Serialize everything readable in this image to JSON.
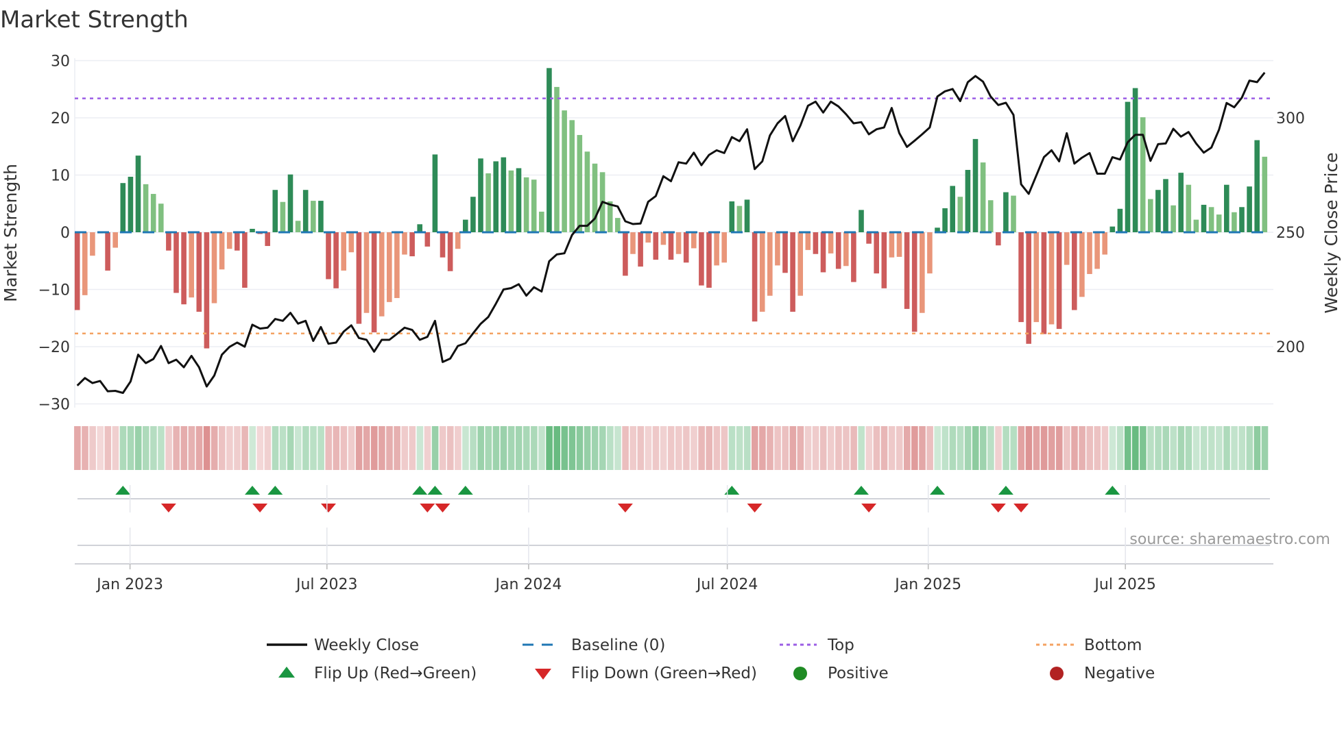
{
  "chart_data": {
    "type": "bar",
    "title": "Market Strength",
    "ylabel": "Market Strength",
    "y2label": "Weekly Close Price",
    "ylim": [
      -30,
      30
    ],
    "y2lim": [
      175,
      325
    ],
    "yticks": [
      30,
      20,
      10,
      0,
      -10,
      -20,
      -30
    ],
    "y2ticks": [
      300,
      250,
      200
    ],
    "top_level": 23.4,
    "bottom_level": -17.7,
    "x_ticks": [
      {
        "label": "Jan 2023",
        "week": 7.93
      },
      {
        "label": "Jul 2023",
        "week": 33.8
      },
      {
        "label": "Jan 2024",
        "week": 60.3
      },
      {
        "label": "Jul 2024",
        "week": 86.4
      },
      {
        "label": "Jan 2025",
        "week": 112.8
      },
      {
        "label": "Jul 2025",
        "week": 138.7
      }
    ],
    "strength": [
      -13.6,
      -11.0,
      -4.1,
      -0.2,
      -6.7,
      -2.7,
      8.6,
      9.7,
      13.4,
      8.4,
      6.7,
      5.0,
      -3.2,
      -10.6,
      -12.6,
      -11.4,
      -13.9,
      -20.3,
      -12.4,
      -6.5,
      -2.9,
      -3.2,
      -9.7,
      0.6,
      -0.3,
      -2.4,
      7.4,
      5.3,
      10.1,
      2.0,
      7.4,
      5.5,
      5.5,
      -8.2,
      -9.8,
      -6.7,
      -3.5,
      -16.0,
      -14.1,
      -17.5,
      -14.7,
      -12.2,
      -11.5,
      -3.9,
      -4.2,
      1.4,
      -2.5,
      13.6,
      -4.4,
      -6.8,
      -2.9,
      2.2,
      6.2,
      12.9,
      10.3,
      12.4,
      13.1,
      10.8,
      11.2,
      9.6,
      9.2,
      3.6,
      28.7,
      25.4,
      21.3,
      19.6,
      17.0,
      14.1,
      12.0,
      10.5,
      5.4,
      2.5,
      -7.6,
      -3.8,
      -6.0,
      -1.8,
      -4.8,
      -2.2,
      -4.8,
      -3.8,
      -5.3,
      -2.8,
      -9.3,
      -9.7,
      -5.8,
      -5.3,
      5.4,
      4.6,
      5.7,
      -15.6,
      -13.9,
      -11.1,
      -5.8,
      -7.1,
      -13.9,
      -11.1,
      -3.1,
      -3.8,
      -7.0,
      -3.7,
      -6.4,
      -5.9,
      -8.7,
      3.9,
      -2.0,
      -7.2,
      -9.8,
      -4.4,
      -4.3,
      -13.4,
      -17.4,
      -14.1,
      -7.2,
      0.8,
      4.2,
      8.1,
      6.2,
      10.9,
      16.3,
      12.2,
      5.6,
      -2.3,
      7.0,
      6.4,
      -15.7,
      -19.5,
      -15.7,
      -17.8,
      -16.1,
      -16.9,
      -5.7,
      -13.6,
      -11.3,
      -7.3,
      -6.4,
      -3.9,
      1.0,
      4.1,
      22.8,
      25.2,
      20.1,
      5.8,
      7.4,
      9.3,
      4.7,
      10.4,
      8.3,
      2.2,
      4.8,
      4.4,
      3.1,
      8.3,
      3.5,
      4.4,
      8.0,
      16.1,
      13.2
    ],
    "weekly_close": [
      183.0,
      186.3,
      184.1,
      185,
      180.5,
      180.7,
      179.8,
      184.8,
      196.5,
      192.8,
      194.6,
      200.3,
      192.8,
      194.3,
      191,
      196,
      191,
      182.6,
      187.4,
      196.5,
      199.9,
      201.8,
      200,
      209.6,
      207.9,
      208.3,
      212.1,
      211.3,
      214.8,
      210.1,
      211.3,
      202.5,
      208.6,
      201.3,
      201.8,
      206.6,
      209.3,
      203.8,
      203,
      197.8,
      203,
      203,
      205.6,
      208.3,
      207.3,
      203,
      204.3,
      211.3,
      193.3,
      194.8,
      200.3,
      201.5,
      205.8,
      210,
      213,
      218.8,
      225,
      225.6,
      227.3,
      222.3,
      226,
      224.1,
      237.3,
      240.3,
      240.8,
      248.8,
      252.8,
      252.8,
      256,
      263.3,
      262.1,
      261.3,
      254.8,
      253.6,
      253.8,
      263.3,
      265.8,
      274.5,
      272.3,
      280.6,
      280,
      284.8,
      279.3,
      283.8,
      285.8,
      284.6,
      291.6,
      289.8,
      295,
      277.6,
      281,
      292.3,
      297.6,
      300.8,
      289.8,
      296.6,
      305.3,
      307.1,
      302.3,
      307.1,
      305,
      301.6,
      297.6,
      298.1,
      292.8,
      295,
      295.8,
      304.3,
      293.3,
      287.3,
      290,
      292.8,
      295.8,
      309.3,
      311.6,
      312.6,
      307.3,
      315.6,
      318.3,
      315.8,
      309.3,
      305.6,
      306.6,
      301.3,
      271,
      266.8,
      274.8,
      282.8,
      285.8,
      281,
      293.3,
      280,
      282.6,
      284.6,
      275.6,
      275.6,
      282.8,
      281.8,
      289.3,
      292.6,
      292.6,
      281.2,
      288.5,
      288.8,
      295.2,
      291.8,
      293.8,
      288.8,
      284.8,
      287,
      294.8,
      306.5,
      304.6,
      308.8,
      316.3,
      315.6,
      319.8
    ],
    "legend": {
      "placement": "bottom",
      "weekly_close": "Weekly Close",
      "baseline": "Baseline (0)",
      "top": "Top",
      "bottom": "Bottom",
      "flip_up": "Flip Up (Red→Green)",
      "flip_down": "Flip Down (Green→Red)",
      "positive": "Positive",
      "negative": "Negative"
    },
    "source": "source: sharemaestro.com"
  },
  "colors": {
    "up_strong": "#2e8b57",
    "up_weak": "#80c080",
    "down_strong": "#cd5c5c",
    "down_weak": "#e9967a",
    "close": "#111111",
    "baseline": "#1f77b4",
    "top": "#9b5de5",
    "bottom": "#f4a261",
    "flip_up": "#1a9641",
    "flip_down": "#d62728",
    "positive": "#1f8b24",
    "negative": "#b22222"
  }
}
